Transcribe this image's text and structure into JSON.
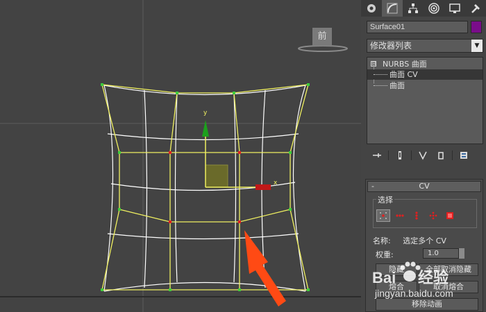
{
  "viewport": {
    "view_label": "前",
    "axis_y": "y",
    "axis_x": "x"
  },
  "panel": {
    "tabs": [
      {
        "icon": "create-icon"
      },
      {
        "icon": "modify-icon"
      },
      {
        "icon": "hierarchy-icon"
      },
      {
        "icon": "motion-icon"
      },
      {
        "icon": "display-icon"
      },
      {
        "icon": "utilities-icon"
      }
    ],
    "object_name": "Surface01",
    "object_color": "#7a0d8a",
    "modifier_list_label": "修改器列表",
    "stack": {
      "root": "NURBS 曲面",
      "root_toggle": "⊟",
      "sub_items": [
        "曲面 CV",
        "曲面"
      ]
    },
    "cv_rollout": {
      "toggle": "-",
      "title": "CV",
      "selection_group": "选择",
      "name_label": "名称:",
      "name_value": "选定多个 CV",
      "weight_label": "权重:",
      "weight_value": "1.0",
      "buttons": {
        "hide": "隐藏",
        "unhide_all": "全部取消隐藏",
        "fuse": "熔合",
        "unfuse": "取消熔合",
        "remove_animation": "移除动画"
      }
    }
  },
  "watermark": {
    "brand": "Baidu",
    "cn_text": "经验",
    "url": "jingyan.baidu.com"
  },
  "colors": {
    "viewport_bg": "#434343",
    "lattice": "#f0f060",
    "surface": "#ffffff",
    "cv_point": "#3ccc3c",
    "cv_selected": "#e02020",
    "arrow": "#ff4a14",
    "gizmo_y": "#1ca01c",
    "gizmo_x": "#c01818",
    "gizmo_plane": "#6a6a2a"
  }
}
